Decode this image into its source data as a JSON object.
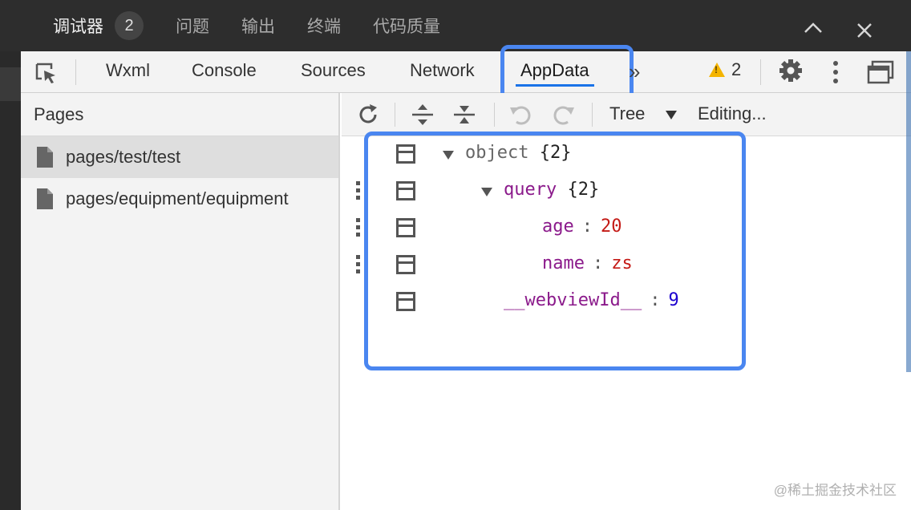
{
  "panel": {
    "tabs": [
      {
        "label": "调试器",
        "badge": "2"
      },
      {
        "label": "问题"
      },
      {
        "label": "输出"
      },
      {
        "label": "终端"
      },
      {
        "label": "代码质量"
      }
    ],
    "collapse_glyph": "︿",
    "close_glyph": "✕"
  },
  "devtools": {
    "tabs": [
      "Wxml",
      "Console",
      "Sources",
      "Network",
      "AppData"
    ],
    "active_tab": "AppData",
    "more_glyph": "»",
    "warning_count": "2",
    "highlight_color": "#4a86f0"
  },
  "sidebar": {
    "title": "Pages",
    "items": [
      {
        "label": "pages/test/test",
        "selected": true
      },
      {
        "label": "pages/equipment/equipment",
        "selected": false
      }
    ]
  },
  "toolbar": {
    "view_mode": "Tree",
    "status": "Editing..."
  },
  "tree": {
    "root": {
      "key": "object",
      "summary": "{2}"
    },
    "query": {
      "key": "query",
      "summary": "{2}"
    },
    "age": {
      "key": "age",
      "value": "20"
    },
    "name": {
      "key": "name",
      "value": "zs"
    },
    "webview": {
      "key": "__webviewId__",
      "value": "9"
    }
  },
  "watermark": "@稀土掘金技术社区"
}
